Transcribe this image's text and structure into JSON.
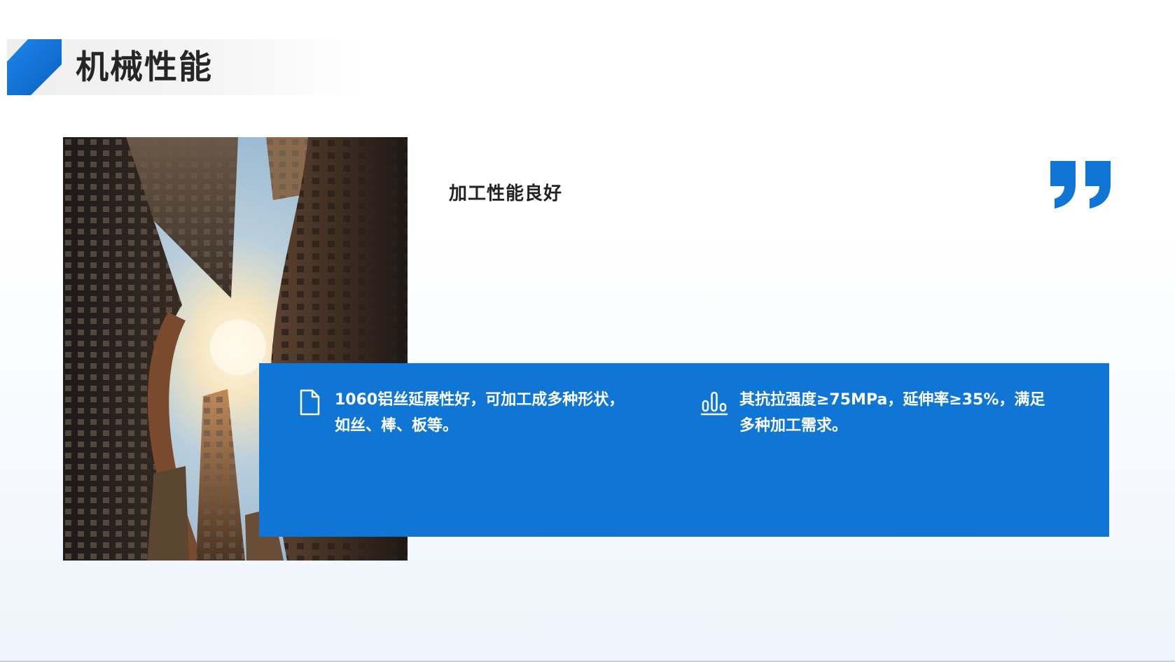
{
  "title": "机械性能",
  "subheading": "加工性能良好",
  "features": [
    {
      "icon": "document-icon",
      "text": "1060铝丝延展性好，可加工成多种形状，如丝、棒、板等。"
    },
    {
      "icon": "bar-chart-icon",
      "text": "其抗拉强度≥75MPa，延伸率≥35%，满足多种加工需求。"
    }
  ],
  "colors": {
    "accent": "#0f76d6",
    "title_text": "#262626",
    "panel_text": "#ffffff"
  },
  "photo": {
    "subject": "building-skyline-photo"
  }
}
